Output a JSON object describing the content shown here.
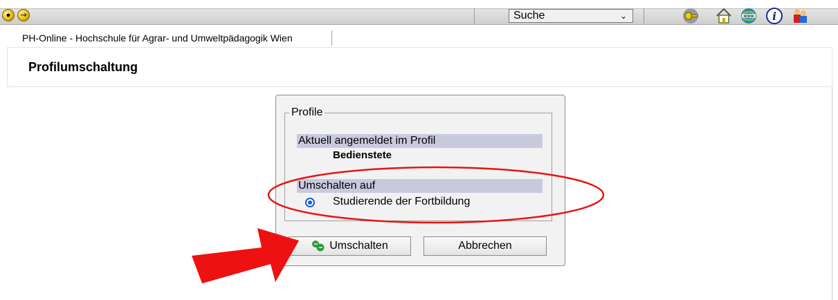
{
  "toolbar": {
    "search_select": "Suche",
    "icons": [
      "back-icon",
      "forward-icon",
      "key-icon",
      "home-icon",
      "www-icon",
      "info-icon",
      "users-icon"
    ]
  },
  "tab": {
    "label": "PH-Online - Hochschule für Agrar- und Umweltpädagogik Wien"
  },
  "page": {
    "title": "Profilumschaltung"
  },
  "dialog": {
    "legend": "Profile",
    "current_heading": "Aktuell angemeldet im Profil",
    "current_value": "Bedienstete",
    "switch_heading": "Umschalten auf",
    "option_label": "Studierende der Fortbildung",
    "switch_button": "Umschalten",
    "cancel_button": "Abbrechen"
  },
  "colors": {
    "section_bar": "#c9c9de",
    "annotation": "#e8140f",
    "radio": "#1a5fd0"
  }
}
